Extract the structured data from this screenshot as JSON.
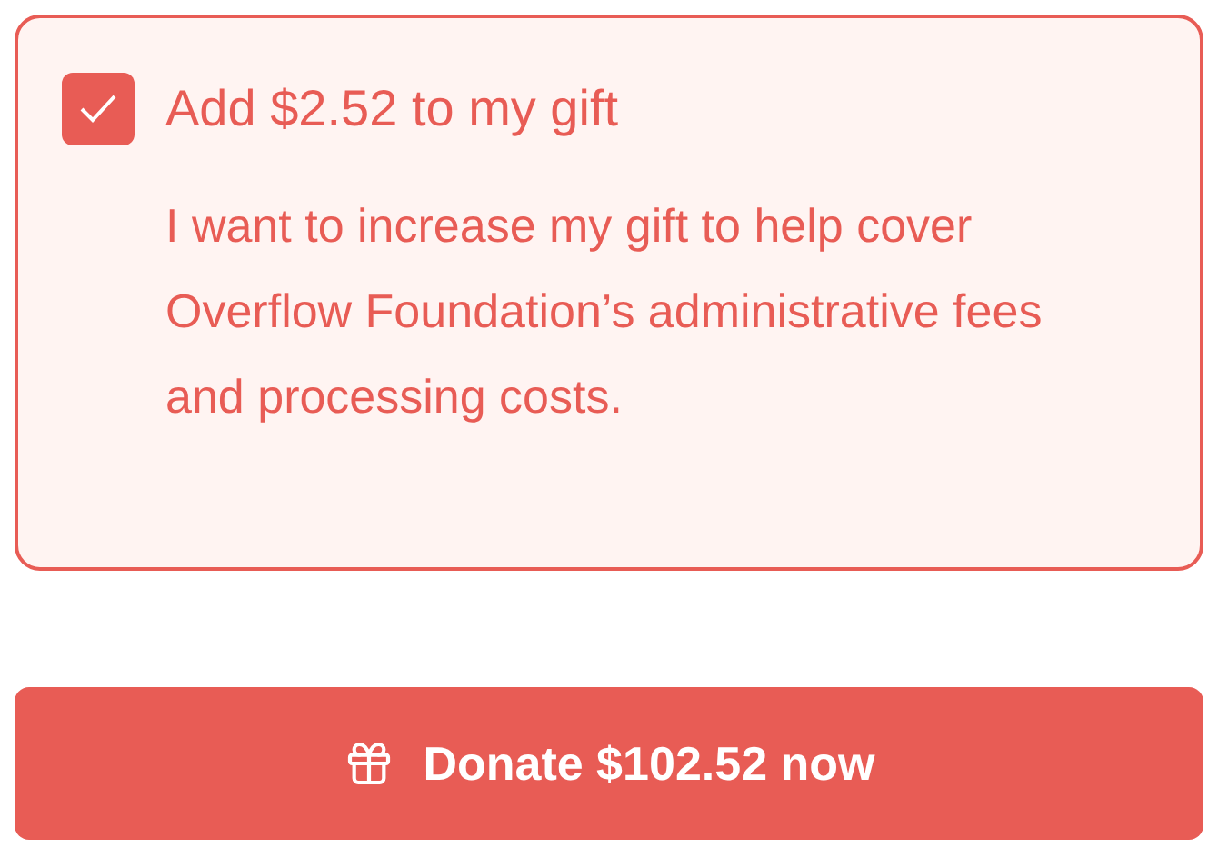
{
  "cover_fees": {
    "checked": true,
    "title": "Add $2.52 to my gift",
    "description": "I want to increase my gift to help cover Overflow Foundation’s administrative fees and processing costs."
  },
  "donate_button": {
    "label": "Donate $102.52 now"
  }
}
